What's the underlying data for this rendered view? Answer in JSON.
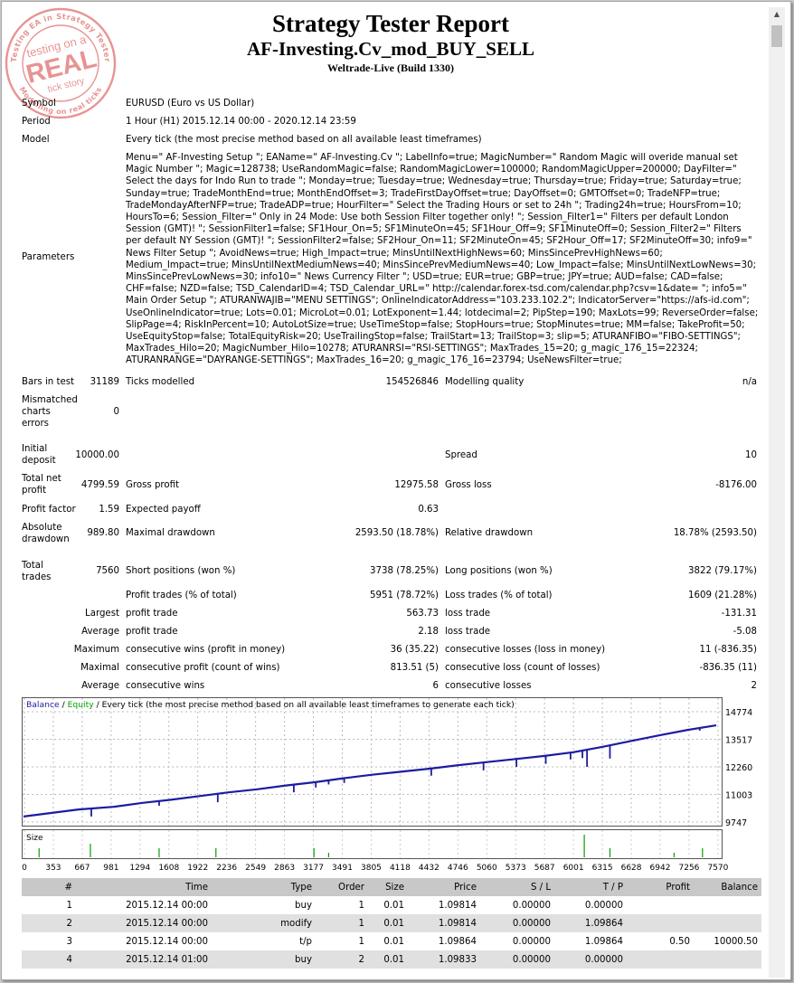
{
  "report": {
    "title": "Strategy Tester Report",
    "expert": "AF-Investing.Cv_mod_BUY_SELL",
    "server": "Weltrade-Live (Build 1330)"
  },
  "stamp": {
    "top": "Testing EA in Strategy Tester",
    "line1": "testing on a",
    "big": "REAL",
    "line3": "tick story",
    "bottom": "Modelling on real ticks"
  },
  "summary": {
    "symbol_label": "Symbol",
    "symbol": "EURUSD (Euro vs US Dollar)",
    "period_label": "Period",
    "period": "1 Hour (H1) 2015.12.14 00:00 - 2020.12.14 23:59",
    "model_label": "Model",
    "model": "Every tick (the most precise method based on all available least timeframes)",
    "parameters_label": "Parameters",
    "parameters": "Menu=\" AF-Investing Setup \"; EAName=\" AF-Investing.Cv \"; LabelInfo=true; MagicNumber=\" Random Magic will overide manual set Magic Number \"; Magic=128738; UseRandomMagic=false; RandomMagicLower=100000; RandomMagicUpper=200000; DayFilter=\" Select the days for Indo Run to trade \"; Monday=true; Tuesday=true; Wednesday=true; Thursday=true; Friday=true; Saturday=true; Sunday=true; TradeMonthEnd=true; MonthEndOffset=3; TradeFirstDayOffset=true; DayOffset=0; GMTOffset=0; TradeNFP=true; TradeMondayAfterNFP=true; TradeADP=true; HourFilter=\" Select the Trading Hours or set to 24h \"; Trading24h=true; HoursFrom=10; HoursTo=6; Session_Filter=\" Only in 24 Mode: Use both Session Filter together only! \"; Session_Filter1=\" Filters per default London Session (GMT)! \"; SessionFilter1=false; SF1Hour_On=5; SF1MinuteOn=45; SF1Hour_Off=9; SF1MinuteOff=0; Session_Filter2=\" Filters per default NY Session (GMT)! \"; SessionFilter2=false; SF2Hour_On=11; SF2MinuteOn=45; SF2Hour_Off=17; SF2MinuteOff=30; info9=\" News Filter Setup \"; AvoidNews=true; High_Impact=true; MinsUntilNextHighNews=60; MinsSincePrevHighNews=60; Medium_Impact=true; MinsUntilNextMediumNews=40; MinsSincePrevMediumNews=40; Low_Impact=false; MinsUntilNextLowNews=30; MinsSincePrevLowNews=30; info10=\" News Currency Filter \"; USD=true; EUR=true; GBP=true; JPY=true; AUD=false; CAD=false; CHF=false; NZD=false; TSD_CalendarID=4; TSD_Calendar_URL=\" http://calendar.forex-tsd.com/calendar.php?csv=1&date= \"; info5=\" Main Order Setup \"; ATURANWAJIB=\"MENU SETTINGS\"; OnlineIndicatorAddress=\"103.233.102.2\"; IndicatorServer=\"https://afs-id.com\"; UseOnlineIndicator=true; Lots=0.01; MicroLot=0.01; LotExponent=1.44; lotdecimal=2; PipStep=190; MaxLots=99; ReverseOrder=false; SlipPage=4; RiskInPercent=10; AutoLotSize=true; UseTimeStop=false; StopHours=true; StopMinutes=true; MM=false; TakeProfit=50; UseEquityStop=false; TotalEquityRisk=20; UseTrailingStop=false; TrailStart=13; TrailStop=3; slip=5; ATURANFIBO=\"FIBO-SETTINGS\"; MaxTrades_Hilo=20; MagicNumber_Hilo=10278; ATURANRSI=\"RSI-SETTINGS\"; MaxTrades_15=20; g_magic_176_15=22324; ATURANRANGE=\"DAYRANGE-SETTINGS\"; MaxTrades_16=20; g_magic_176_16=23794; UseNewsFilter=true;"
  },
  "stats": {
    "bars_label": "Bars in test",
    "bars": "31189",
    "ticks_label": "Ticks modelled",
    "ticks": "154526846",
    "quality_label": "Modelling quality",
    "quality": "n/a",
    "mismatch_l1": "Mismatched",
    "mismatch_l2": "charts",
    "mismatch_l3": "errors",
    "mismatch": "0",
    "deposit_l1": "Initial",
    "deposit_l2": "deposit",
    "deposit": "10000.00",
    "spread_label": "Spread",
    "spread": "10",
    "netprofit_l1": "Total net",
    "netprofit_l2": "profit",
    "netprofit": "4799.59",
    "grossprofit_label": "Gross profit",
    "grossprofit": "12975.58",
    "grossloss_label": "Gross loss",
    "grossloss": "-8176.00",
    "pf_label": "Profit factor",
    "pf": "1.59",
    "payoff_label": "Expected payoff",
    "payoff": "0.63",
    "absdd_l1": "Absolute",
    "absdd_l2": "drawdown",
    "absdd": "989.80",
    "maxdd_label": "Maximal drawdown",
    "maxdd": "2593.50 (18.78%)",
    "reldd_label": "Relative drawdown",
    "reldd": "18.78% (2593.50)",
    "trades_l1": "Total",
    "trades_l2": "trades",
    "trades": "7560",
    "short_label": "Short positions (won %)",
    "short": "3738 (78.25%)",
    "long_label": "Long positions (won %)",
    "long": "3822 (79.17%)",
    "ptrades_label": "Profit trades (% of total)",
    "ptrades": "5951 (78.72%)",
    "ltrades_label": "Loss trades (% of total)",
    "ltrades": "1609 (21.28%)",
    "largest_label": "Largest",
    "lp_label": "profit trade",
    "lp": "563.73",
    "ll_label": "loss trade",
    "ll": "-131.31",
    "average_label": "Average",
    "ap_label": "profit trade",
    "ap": "2.18",
    "al_label": "loss trade",
    "al": "-5.08",
    "maximum_label": "Maximum",
    "mcw_label": "consecutive wins (profit in money)",
    "mcw": "36 (35.22)",
    "mcl_label": "consecutive losses (loss in money)",
    "mcl": "11 (-836.35)",
    "maximal_label": "Maximal",
    "mcp_label": "consecutive profit (count of wins)",
    "mcp": "813.51 (5)",
    "mcloss_label": "consecutive loss (count of losses)",
    "mcloss": "-836.35 (11)",
    "average2_label": "Average",
    "acw_label": "consecutive wins",
    "acw": "6",
    "acl_label": "consecutive losses",
    "acl": "2"
  },
  "chart_data": {
    "type": "line",
    "legend": {
      "balance": "Balance",
      "sep": " / ",
      "equity": "Equity",
      "rest": " / Every tick (the most precise method based on all available least timeframes to generate each tick)"
    },
    "colors": {
      "balance": "#1c1ca0",
      "equity": "#00a000",
      "size": "#00a000"
    },
    "y_ticks": [
      14774,
      13517,
      12260,
      11003,
      9747
    ],
    "ylim": [
      9747,
      14774
    ],
    "x_ticks": [
      "0",
      "353",
      "667",
      "981",
      "1294",
      "1608",
      "1922",
      "2236",
      "2549",
      "2863",
      "3177",
      "3491",
      "3805",
      "4118",
      "4432",
      "4746",
      "5060",
      "5373",
      "5687",
      "6001",
      "6315",
      "6628",
      "6942",
      "7256",
      "7570"
    ],
    "xlim": [
      0,
      7560
    ],
    "size_label": "Size",
    "balance_points": [
      [
        0,
        10000
      ],
      [
        300,
        10160
      ],
      [
        600,
        10320
      ],
      [
        981,
        10440
      ],
      [
        1300,
        10620
      ],
      [
        1608,
        10760
      ],
      [
        1922,
        10930
      ],
      [
        2236,
        11100
      ],
      [
        2549,
        11240
      ],
      [
        2863,
        11410
      ],
      [
        3177,
        11560
      ],
      [
        3491,
        11740
      ],
      [
        3805,
        11900
      ],
      [
        4118,
        12040
      ],
      [
        4432,
        12180
      ],
      [
        4746,
        12340
      ],
      [
        5060,
        12480
      ],
      [
        5373,
        12620
      ],
      [
        5687,
        12760
      ],
      [
        6001,
        12930
      ],
      [
        6315,
        13170
      ],
      [
        6628,
        13440
      ],
      [
        6942,
        13700
      ],
      [
        7256,
        13950
      ],
      [
        7560,
        14150
      ]
    ],
    "drops": [
      [
        740,
        10000
      ],
      [
        1480,
        10490
      ],
      [
        2120,
        10650
      ],
      [
        2950,
        11100
      ],
      [
        3190,
        11320
      ],
      [
        3330,
        11460
      ],
      [
        3500,
        11530
      ],
      [
        4450,
        11860
      ],
      [
        5020,
        12100
      ],
      [
        5380,
        12260
      ],
      [
        5700,
        12400
      ],
      [
        5970,
        12600
      ],
      [
        6100,
        12660
      ],
      [
        6150,
        12260
      ],
      [
        6400,
        12640
      ],
      [
        7380,
        13910
      ]
    ],
    "size_spikes": [
      [
        170,
        2
      ],
      [
        730,
        3
      ],
      [
        1480,
        2
      ],
      [
        2100,
        2
      ],
      [
        3170,
        2
      ],
      [
        3330,
        1
      ],
      [
        6120,
        5
      ],
      [
        6400,
        2
      ],
      [
        7100,
        1
      ],
      [
        7410,
        2
      ]
    ]
  },
  "trades": {
    "headers": [
      "#",
      "Time",
      "Type",
      "Order",
      "Size",
      "Price",
      "S / L",
      "T / P",
      "Profit",
      "Balance"
    ],
    "rows": [
      [
        "1",
        "2015.12.14 00:00",
        "buy",
        "1",
        "0.01",
        "1.09814",
        "0.00000",
        "0.00000",
        "",
        ""
      ],
      [
        "2",
        "2015.12.14 00:00",
        "modify",
        "1",
        "0.01",
        "1.09814",
        "0.00000",
        "1.09864",
        "",
        ""
      ],
      [
        "3",
        "2015.12.14 00:00",
        "t/p",
        "1",
        "0.01",
        "1.09864",
        "0.00000",
        "1.09864",
        "0.50",
        "10000.50"
      ],
      [
        "4",
        "2015.12.14 01:00",
        "buy",
        "2",
        "0.01",
        "1.09833",
        "0.00000",
        "0.00000",
        "",
        ""
      ]
    ]
  }
}
